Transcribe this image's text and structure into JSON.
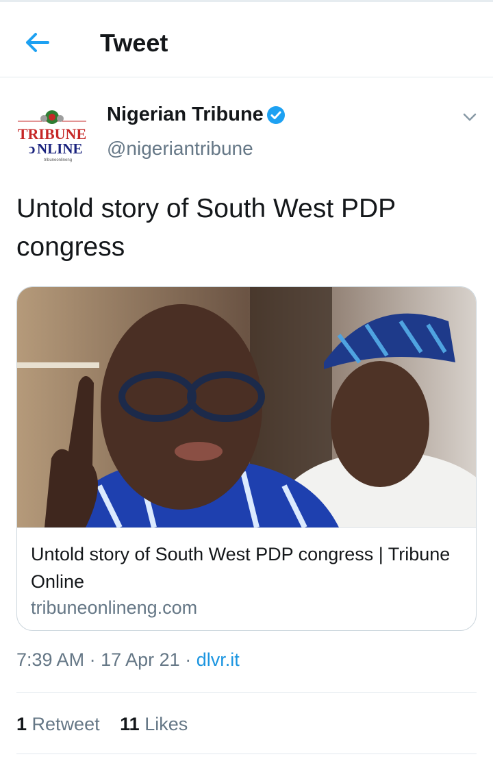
{
  "header": {
    "title": "Tweet",
    "back_icon": "arrow-left-icon",
    "accent": "#1da1f2"
  },
  "tweet": {
    "author_name": "Nigerian Tribune",
    "author_handle": "@nigeriantribune",
    "verified": true,
    "avatar_text": {
      "line1": "TRIBUNE",
      "line2": "NLINE",
      "small": "tribuneonlineng"
    },
    "text": "Untold story of South West PDP congress",
    "card": {
      "title": "Untold story of South West PDP congress | Tribune Online",
      "domain": "tribuneonlineng.com"
    },
    "time": "7:39 AM",
    "date": "17 Apr 21",
    "source": "dlvr.it",
    "retweets_count": "1",
    "retweets_label": "Retweet",
    "likes_count": "11",
    "likes_label": "Likes"
  }
}
